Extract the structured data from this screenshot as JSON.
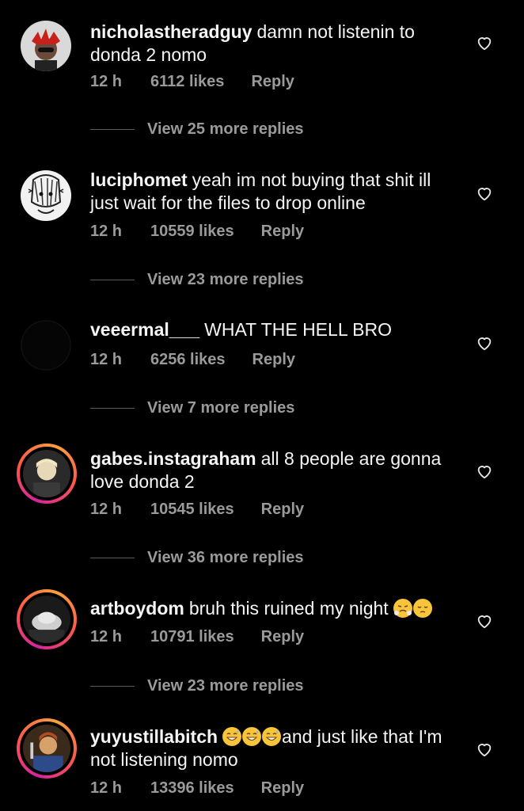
{
  "comments": [
    {
      "username": "nicholastheradguy",
      "text": "damn not listenin to donda 2 nomo",
      "time": "12 h",
      "likes": "6112 likes",
      "reply": "Reply",
      "view_more": "View 25 more replies"
    },
    {
      "username": "luciphomet",
      "text": "yeah im not buying that shit ill just wait for the files to drop online",
      "time": "12 h",
      "likes": "10559 likes",
      "reply": "Reply",
      "view_more": "View 23 more replies"
    },
    {
      "username": "veeermal___",
      "text": "WHAT THE HELL BRO",
      "time": "12 h",
      "likes": "6256 likes",
      "reply": "Reply",
      "view_more": "View 7 more replies"
    },
    {
      "username": "gabes.instagraham",
      "text": "all 8 people are gonna love donda 2",
      "time": "12 h",
      "likes": "10545 likes",
      "reply": "Reply",
      "view_more": "View 36 more replies"
    },
    {
      "username": "artboydom",
      "text": "bruh this ruined my night",
      "time": "12 h",
      "likes": "10791 likes",
      "reply": "Reply",
      "view_more": "View 23 more replies"
    },
    {
      "username": "yuyustillabitch",
      "text": "and just like that I'm not listening nomo",
      "time": "12 h",
      "likes": "13396 likes",
      "reply": "Reply"
    }
  ],
  "icons": {
    "like": "heart-outline-icon"
  },
  "colors": {
    "background": "#000000",
    "primary_text": "#f5f5f5",
    "secondary_text": "#9a9a9a",
    "story_ring_start": "#d6249f",
    "story_ring_end": "#f9a03f"
  }
}
